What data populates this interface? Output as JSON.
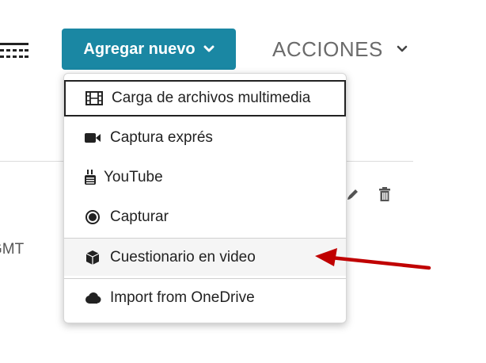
{
  "toolbar": {
    "add_new_label": "Agregar nuevo",
    "actions_label": "ACCIONES"
  },
  "background": {
    "timezone_fragment": "GMT"
  },
  "dropdown": {
    "items": [
      {
        "label": "Carga de archivos multimedia",
        "icon": "film-icon"
      },
      {
        "label": "Captura exprés",
        "icon": "video-camera-icon"
      },
      {
        "label": "YouTube",
        "icon": "youtube-icon"
      },
      {
        "label": "Capturar",
        "icon": "record-icon"
      },
      {
        "label": "Cuestionario en video",
        "icon": "cube-icon"
      },
      {
        "label": "Import from OneDrive",
        "icon": "cloud-icon"
      }
    ]
  },
  "colors": {
    "accent": "#1a87a3",
    "arrow": "#c00000"
  }
}
